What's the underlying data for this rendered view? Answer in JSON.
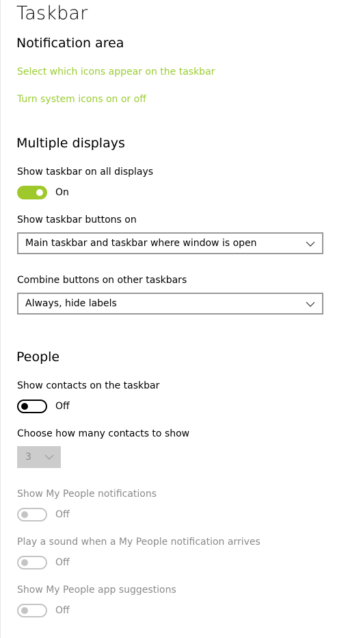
{
  "colors": {
    "accent": "#9acd32",
    "toggle_on_bg": "#9fc92b",
    "text": "#000000",
    "disabled_text": "#8a8a8a"
  },
  "page": {
    "title": "Taskbar"
  },
  "notification_area": {
    "heading": "Notification area",
    "link_select_icons": "Select which icons appear on the taskbar",
    "link_system_icons": "Turn system icons on or off"
  },
  "multiple_displays": {
    "heading": "Multiple displays",
    "show_taskbar_all_label": "Show taskbar on all displays",
    "show_taskbar_all_state": "On",
    "buttons_on_label": "Show taskbar buttons on",
    "buttons_on_value": "Main taskbar and taskbar where window is open",
    "combine_label": "Combine buttons on other taskbars",
    "combine_value": "Always, hide labels"
  },
  "people": {
    "heading": "People",
    "show_contacts_label": "Show contacts on the taskbar",
    "show_contacts_state": "Off",
    "how_many_label": "Choose how many contacts to show",
    "how_many_value": "3",
    "notifications_label": "Show My People notifications",
    "notifications_state": "Off",
    "sound_label": "Play a sound when a My People notification arrives",
    "sound_state": "Off",
    "suggestions_label": "Show My People app suggestions",
    "suggestions_state": "Off"
  }
}
